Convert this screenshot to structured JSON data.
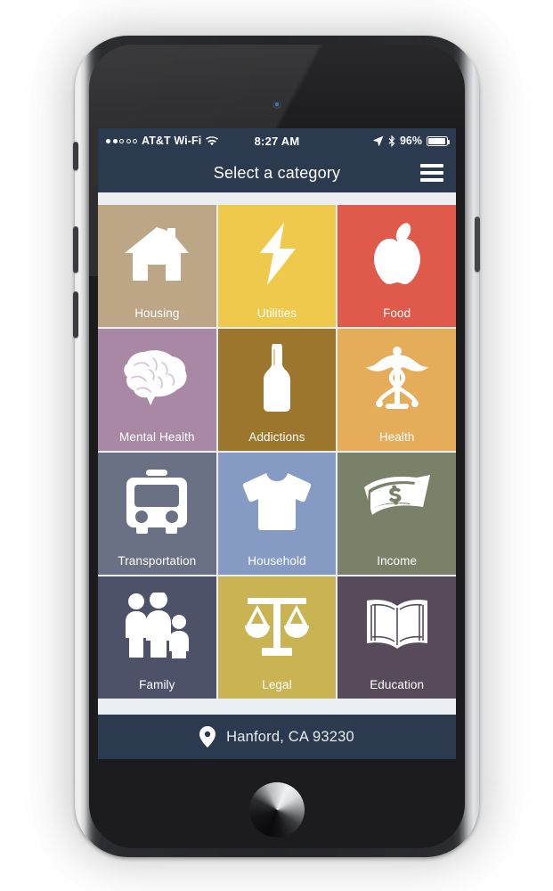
{
  "device": {
    "hardware": {
      "camera": "front-camera",
      "speaker": "earpiece-speaker",
      "sensor": "proximity-sensor",
      "home_button": "home-button"
    }
  },
  "statusbar": {
    "signal_dots_filled": 2,
    "signal_dots_total": 5,
    "carrier": "AT&T Wi-Fi",
    "wifi_icon": "wifi-icon",
    "time": "8:27 AM",
    "location_arrow_icon": "location-arrow-icon",
    "bluetooth_icon": "bluetooth-icon",
    "battery_percent": "96%",
    "battery_icon": "battery-icon"
  },
  "navbar": {
    "title": "Select a category",
    "menu_icon": "hamburger-menu-icon"
  },
  "grid": {
    "tiles": [
      {
        "label": "Housing",
        "icon": "house-icon",
        "color": "#BCA685"
      },
      {
        "label": "Utilities",
        "icon": "lightning-bolt-icon",
        "color": "#EFC94C"
      },
      {
        "label": "Food",
        "icon": "apple-icon",
        "color": "#E05A4B"
      },
      {
        "label": "Mental Health",
        "icon": "brain-icon",
        "color": "#A988A5"
      },
      {
        "label": "Addictions",
        "icon": "bottle-icon",
        "color": "#9C762C"
      },
      {
        "label": "Health",
        "icon": "caduceus-icon",
        "color": "#E5AC5A"
      },
      {
        "label": "Transportation",
        "icon": "bus-icon",
        "color": "#6B7185"
      },
      {
        "label": "Household",
        "icon": "tshirt-icon",
        "color": "#869BC4"
      },
      {
        "label": "Income",
        "icon": "money-icon",
        "color": "#7A8169"
      },
      {
        "label": "Family",
        "icon": "family-icon",
        "color": "#4E5268"
      },
      {
        "label": "Legal",
        "icon": "scales-icon",
        "color": "#C9B352"
      },
      {
        "label": "Education",
        "icon": "open-book-icon",
        "color": "#564A5B"
      }
    ]
  },
  "location_bar": {
    "pin_icon": "map-pin-icon",
    "text": "Hanford, CA 93230"
  },
  "theme": {
    "chrome_color": "#2B3A4E",
    "screen_background": "#ECEFF1",
    "tile_text_color": "#FFFFFF"
  }
}
